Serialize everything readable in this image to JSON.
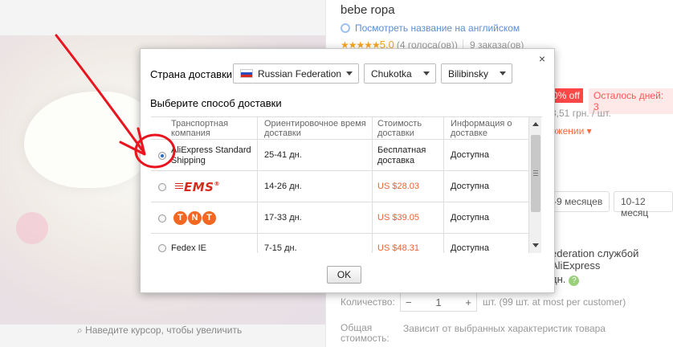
{
  "page": {
    "title_snippet": "bebe ropa",
    "translate_link": "Посмотреть название на английском",
    "rating": {
      "stars": "★★★★★",
      "score": "5.0",
      "votes": "(4 голоса(ов))",
      "orders": "9 заказа(ов)"
    },
    "discount_badge": "0% off",
    "time_left": "Осталось дней: 3",
    "price_unit": "3,51 грн. / шт.",
    "installment": "ожении ▾",
    "size_chips": [
      "-9 месяцев",
      "10-12 месяц"
    ],
    "ship_to": "ederation службой AliExpress",
    "ship_days": "дн.",
    "ship_help": "?",
    "quantity_label": "Количество:",
    "quantity": {
      "minus": "−",
      "value": "1",
      "plus": "+"
    },
    "quantity_note": "шт. (99 шт. at most per customer)",
    "total_label": "Общая стоимость:",
    "total_note": "Зависит от выбранных характеристик товара",
    "zoom_hint": "Наведите курсор, чтобы увеличить"
  },
  "modal": {
    "close_glyph": "×",
    "country_label": "Страна доставки:",
    "country": "Russian Federation",
    "region": "Chukotka",
    "city": "Bilibinsky",
    "method_title": "Выберите способ доставки",
    "columns": [
      "Транспортная компания",
      "Ориентировочное время доставки",
      "Стоимость доставки",
      "Информация о доставке"
    ],
    "rows": [
      {
        "carrier": "AliExpress Standard Shipping",
        "logo": "",
        "time": "25-41 дн.",
        "cost": "Бесплатная доставка",
        "cost_free": true,
        "info": "Доступна",
        "selected": true
      },
      {
        "carrier": "",
        "logo": "EMS",
        "time": "14-26 дн.",
        "cost": "US $28.03",
        "cost_free": false,
        "info": "Доступна",
        "selected": false
      },
      {
        "carrier": "",
        "logo": "TNT",
        "time": "17-33 дн.",
        "cost": "US $39.05",
        "cost_free": false,
        "info": "Доступна",
        "selected": false
      },
      {
        "carrier": "Fedex IE",
        "logo": "",
        "time": "7-15 дн.",
        "cost": "US $48.31",
        "cost_free": false,
        "info": "Доступна",
        "selected": false
      }
    ],
    "ok_label": "OK"
  },
  "colors": {
    "price_red": "#f06030",
    "annotation_red": "#e8141e",
    "link_blue": "#5b8dd6"
  }
}
